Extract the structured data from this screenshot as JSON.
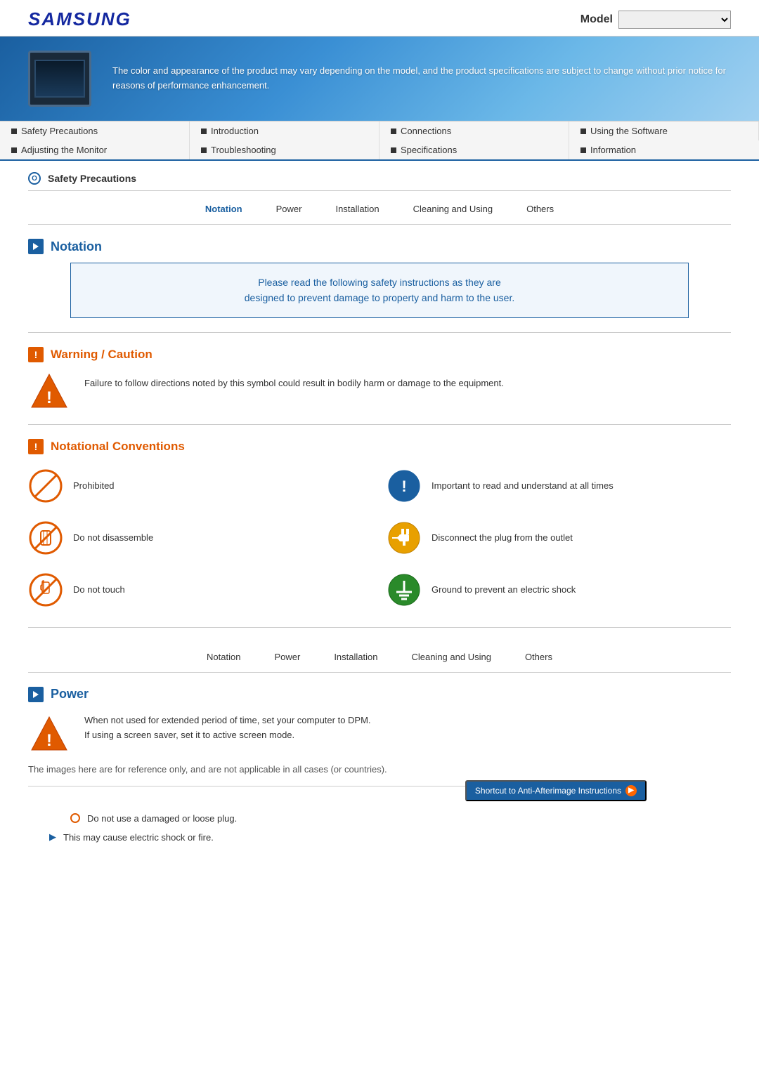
{
  "header": {
    "logo": "SAMSUNG",
    "model_label": "Model",
    "model_placeholder": ""
  },
  "banner": {
    "text": "The color and appearance of the product may vary depending on the model, and the product specifications are subject to change without prior notice for reasons of performance enhancement."
  },
  "nav": {
    "rows": [
      [
        {
          "label": "Safety Precautions",
          "id": "safety"
        },
        {
          "label": "Introduction",
          "id": "intro"
        },
        {
          "label": "Connections",
          "id": "connections"
        },
        {
          "label": "Using the Software",
          "id": "software"
        }
      ],
      [
        {
          "label": "Adjusting the Monitor",
          "id": "adjusting"
        },
        {
          "label": "Troubleshooting",
          "id": "troubleshoot"
        },
        {
          "label": "Specifications",
          "id": "specs"
        },
        {
          "label": "Information",
          "id": "info"
        }
      ]
    ]
  },
  "breadcrumb": {
    "title": "Safety Precautions"
  },
  "sub_nav": {
    "items": [
      {
        "label": "Notation",
        "id": "notation",
        "active": true
      },
      {
        "label": "Power",
        "id": "power"
      },
      {
        "label": "Installation",
        "id": "installation"
      },
      {
        "label": "Cleaning and Using",
        "id": "cleaning"
      },
      {
        "label": "Others",
        "id": "others"
      }
    ]
  },
  "notation_section": {
    "title": "Notation",
    "notice": {
      "line1": "Please read the following safety instructions as they are",
      "line2": "designed to prevent damage to property and harm to the user."
    },
    "warning": {
      "title": "Warning / Caution",
      "text": "Failure to follow directions noted by this symbol could result in bodily harm or damage to the equipment."
    },
    "conventions": {
      "title": "Notational Conventions",
      "items": [
        {
          "icon_type": "prohibited",
          "label": "Prohibited",
          "col": 1
        },
        {
          "icon_type": "important",
          "label": "Important to read and understand at all times",
          "col": 2
        },
        {
          "icon_type": "no-disassemble",
          "label": "Do not disassemble",
          "col": 1
        },
        {
          "icon_type": "disconnect",
          "label": "Disconnect the plug from the outlet",
          "col": 2
        },
        {
          "icon_type": "no-touch",
          "label": "Do not touch",
          "col": 1
        },
        {
          "icon_type": "ground",
          "label": "Ground to prevent an electric shock",
          "col": 2
        }
      ]
    }
  },
  "sub_nav_2": {
    "items": [
      {
        "label": "Notation",
        "id": "notation2"
      },
      {
        "label": "Power",
        "id": "power2"
      },
      {
        "label": "Installation",
        "id": "installation2"
      },
      {
        "label": "Cleaning and Using",
        "id": "cleaning2"
      },
      {
        "label": "Others",
        "id": "others2"
      }
    ]
  },
  "power_section": {
    "title": "Power",
    "warning_text_line1": "When not used for extended period of time, set your computer to DPM.",
    "warning_text_line2": "If using a screen saver, set it to active screen mode.",
    "reference_text": "The images here are for reference only, and are not applicable in all cases (or countries).",
    "shortcut_btn": "Shortcut to Anti-Afterimage Instructions"
  },
  "bullet_list": {
    "items": [
      {
        "type": "main",
        "text": "Do not use a damaged or loose plug."
      },
      {
        "type": "sub",
        "text": "This may cause electric shock or fire."
      }
    ]
  }
}
